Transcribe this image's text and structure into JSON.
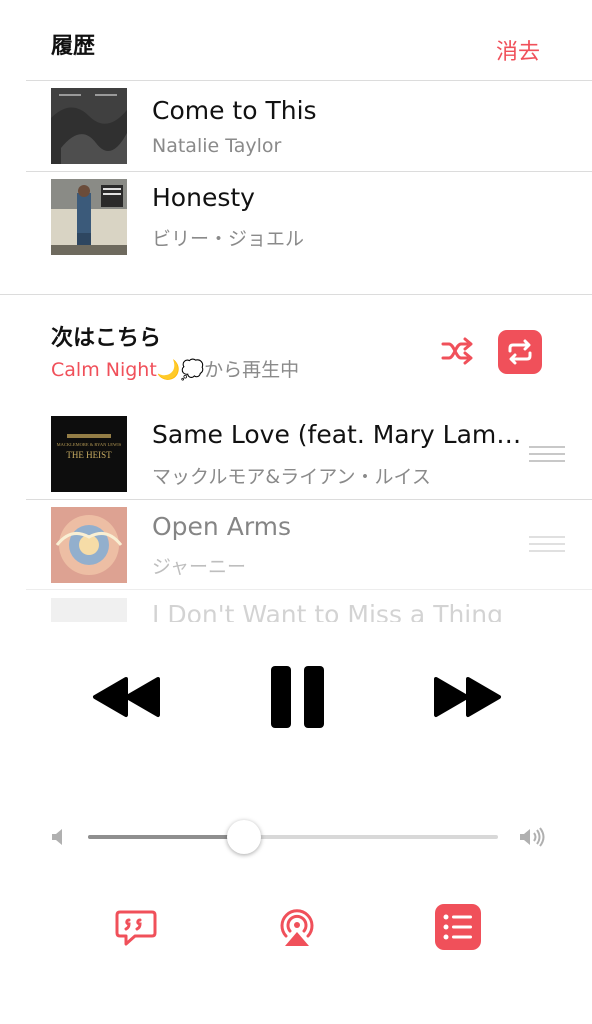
{
  "history": {
    "title": "履歴",
    "clear_label": "消去",
    "items": [
      {
        "title": "Come to This",
        "artist": "Natalie Taylor"
      },
      {
        "title": "Honesty",
        "artist": "ビリー・ジョエル"
      }
    ]
  },
  "up_next": {
    "title": "次はこちら",
    "source_name": "Calm Night🌙💭",
    "source_suffix": "から再生中",
    "items": [
      {
        "title": "Same Love (feat. Mary Lamb...",
        "artist": "マックルモア&ライアン・ルイス"
      },
      {
        "title": "Open Arms",
        "artist": "ジャーニー"
      },
      {
        "title": "I Don't Want to Miss a Thing",
        "artist": ""
      }
    ]
  },
  "album_art_text": {
    "heist": "THE HEIST",
    "heist_artist": "MACKLEMORE & RYAN LEWIS"
  },
  "volume": {
    "level": 0.38
  },
  "colors": {
    "accent": "#f0505a"
  },
  "icons": [
    "shuffle-icon",
    "repeat-icon",
    "rewind-icon",
    "pause-icon",
    "fast-forward-icon",
    "volume-low-icon",
    "volume-high-icon",
    "lyrics-icon",
    "airplay-icon",
    "queue-list-icon"
  ]
}
